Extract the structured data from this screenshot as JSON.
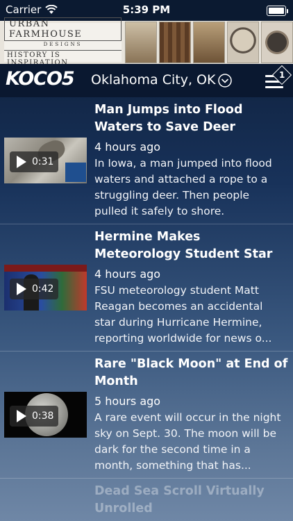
{
  "status_bar": {
    "carrier": "Carrier",
    "time": "5:39 PM"
  },
  "ad": {
    "brand": "URBAN FARMHOUSE",
    "brand_sub": "DESIGNS",
    "tagline": "HISTORY IS INSPIRATION"
  },
  "header": {
    "logo": "KOCO5",
    "location": "Oklahoma City, OK",
    "menu_badge": "1"
  },
  "stories": [
    {
      "title": "Man Jumps into Flood Waters to Save Deer",
      "time_ago": "4 hours ago",
      "description": "In Iowa, a man jumped into flood waters and attached a rope to a struggling deer. Then people pulled it safely to shore.",
      "duration": "0:31"
    },
    {
      "title": "Hermine Makes Meteorology Student Star",
      "time_ago": "4 hours ago",
      "description": "FSU meteorology student Matt Reagan becomes an accidental star during Hurricane Hermine, reporting worldwide for news o...",
      "duration": "0:42"
    },
    {
      "title": "Rare \"Black Moon\" at End of Month",
      "time_ago": "5 hours ago",
      "description": "A rare event will occur in the night sky on Sept. 30. The moon will be dark for the second time in a month, something that has...",
      "duration": "0:38"
    },
    {
      "title": "Dead Sea Scroll Virtually Unrolled"
    }
  ],
  "colors": {
    "nav_background": "#0a1830",
    "text": "#ffffff"
  }
}
